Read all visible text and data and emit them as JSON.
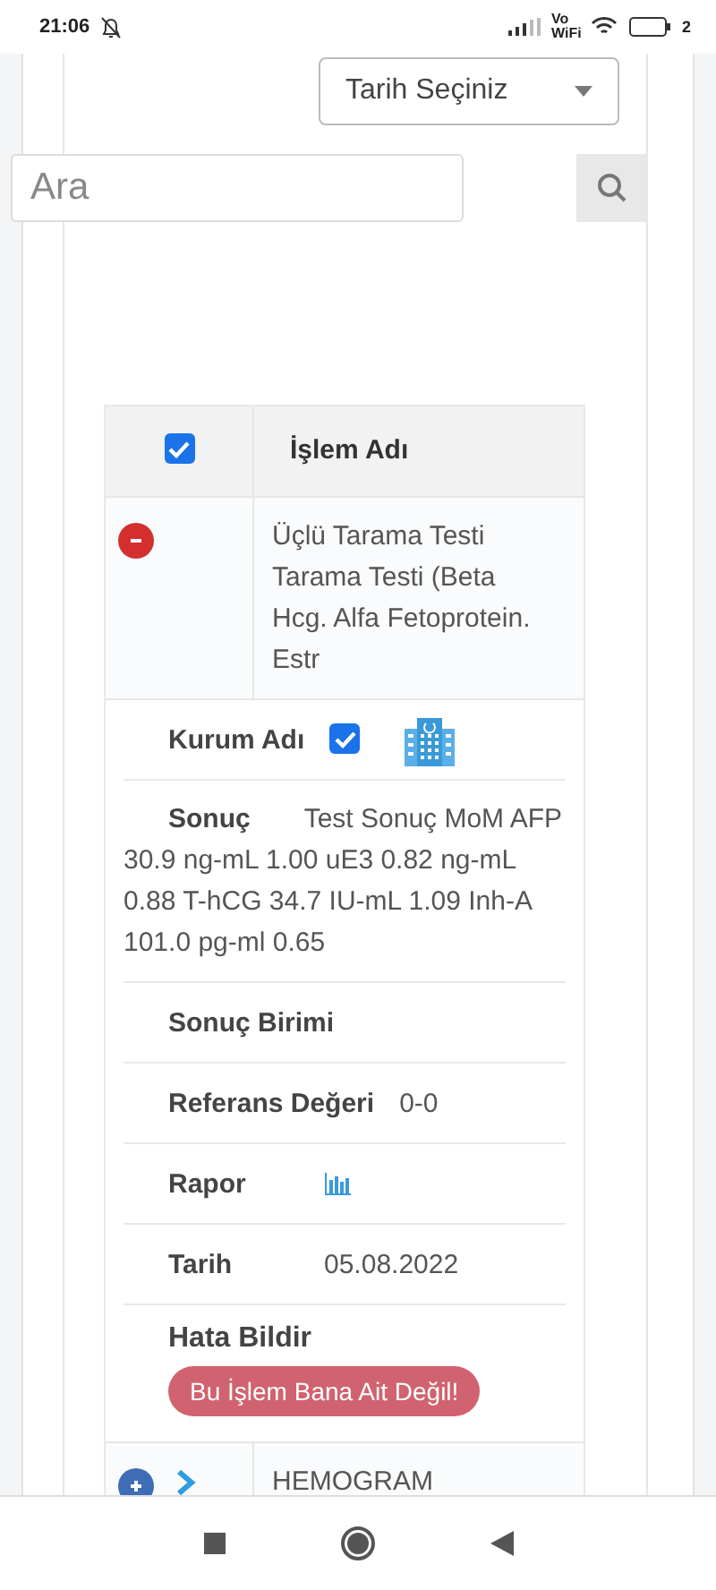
{
  "status_bar": {
    "time": "21:06",
    "network": "Vo WiFi",
    "battery": "2"
  },
  "date_select": {
    "value": "Tarih Seçiniz"
  },
  "search": {
    "placeholder": "Ara"
  },
  "table": {
    "header": {
      "checked": true,
      "title": "İşlem Adı"
    },
    "rows": [
      {
        "expanded": true,
        "name": "Üçlü Tarama Testi Tarama Testi (Beta Hcg. Alfa Fetoprotein. Estr",
        "details": [
          {
            "kind": "checkbox",
            "label": "Kurum Adı",
            "checked": true
          },
          {
            "kind": "wrap",
            "label": "Sonuç",
            "value": "Test Sonuç MoM AFP 30.9 ng-mL 1.00 uE3 0.82 ng-mL 0.88 T-hCG 34.7 IU-mL 1.09 Inh-A 101.0 pg-ml 0.65"
          },
          {
            "kind": "text",
            "label": "Sonuç Birimi"
          },
          {
            "kind": "text",
            "label": "Referans Değeri",
            "value": "0-0"
          },
          {
            "kind": "chart",
            "label": "Rapor"
          },
          {
            "kind": "text",
            "label": "Tarih",
            "value": "05.08.2022"
          },
          {
            "kind": "button",
            "label": "Hata Bildir",
            "button": "Bu İşlem Bana Ait Değil!"
          }
        ]
      },
      {
        "expanded": false,
        "name": "HEMOGRAM"
      }
    ]
  }
}
